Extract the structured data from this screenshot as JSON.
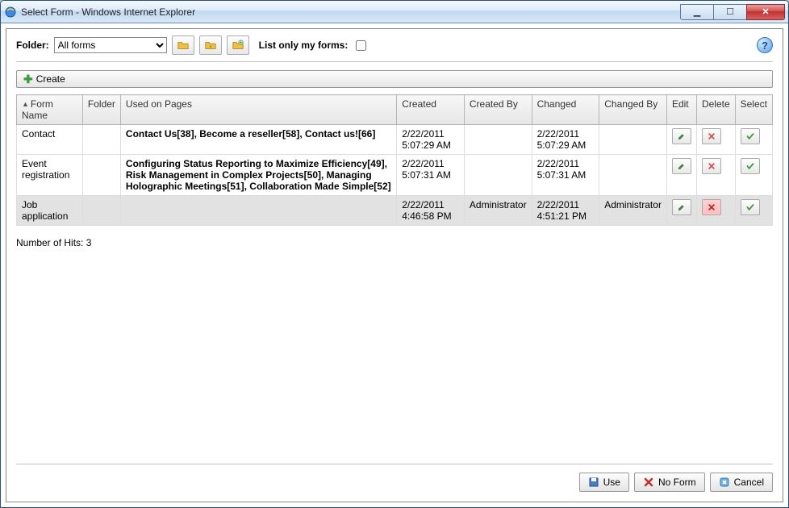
{
  "window": {
    "title": "Select Form - Windows Internet Explorer"
  },
  "toolbar": {
    "folder_label": "Folder:",
    "folder_value": "All forms",
    "list_only_label": "List only my forms:",
    "create_label": "Create",
    "help_glyph": "?"
  },
  "columns": {
    "form_name": "Form Name",
    "folder": "Folder",
    "used_on_pages": "Used on Pages",
    "created": "Created",
    "created_by": "Created By",
    "changed": "Changed",
    "changed_by": "Changed By",
    "edit": "Edit",
    "delete": "Delete",
    "select": "Select"
  },
  "rows": [
    {
      "name": "Contact",
      "folder": "",
      "pages": "Contact Us[38], Become a reseller[58], Contact us![66]",
      "created": "2/22/2011 5:07:29 AM",
      "created_by": "",
      "changed": "2/22/2011 5:07:29 AM",
      "changed_by": ""
    },
    {
      "name": "Event registration",
      "folder": "",
      "pages": "Configuring Status Reporting to Maximize Efficiency[49], Risk Management in Complex Projects[50], Managing Holographic Meetings[51], Collaboration Made Simple[52]",
      "created": "2/22/2011 5:07:31 AM",
      "created_by": "",
      "changed": "2/22/2011 5:07:31 AM",
      "changed_by": ""
    },
    {
      "name": "Job application",
      "folder": "",
      "pages": "",
      "created": "2/22/2011 4:46:58 PM",
      "created_by": "Administrator",
      "changed": "2/22/2011 4:51:21 PM",
      "changed_by": "Administrator"
    }
  ],
  "hits": {
    "label": "Number of Hits: 3"
  },
  "footer": {
    "use": "Use",
    "no_form": "No Form",
    "cancel": "Cancel"
  }
}
